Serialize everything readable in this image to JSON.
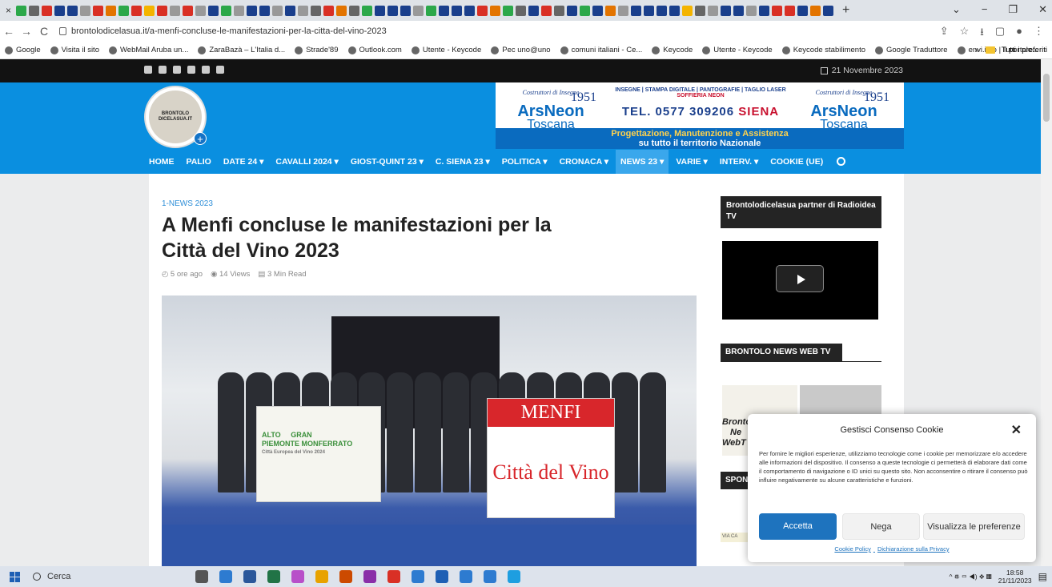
{
  "browser": {
    "tab_icon_colors": [
      "#2ca84a",
      "#666",
      "#d93025",
      "#1a3f8c",
      "#1a3f8c",
      "#999",
      "#d93025",
      "#e37400",
      "#2ca84a",
      "#d93025",
      "#f4b400",
      "#d93025",
      "#999",
      "#d93025",
      "#999",
      "#1a3f8c",
      "#2ca84a",
      "#999",
      "#1a3f8c",
      "#1a3f8c",
      "#999",
      "#1a3f8c",
      "#999",
      "#666",
      "#d93025",
      "#e37400",
      "#666",
      "#2ca84a",
      "#1a3f8c",
      "#1a3f8c",
      "#1a3f8c",
      "#999",
      "#2ca84a",
      "#1a3f8c",
      "#1a3f8c",
      "#1a3f8c",
      "#d93025",
      "#e37400",
      "#2ca84a",
      "#666",
      "#1a3f8c",
      "#d93025",
      "#666",
      "#1a3f8c",
      "#2ca84a",
      "#1a3f8c",
      "#e37400",
      "#999",
      "#1a3f8c",
      "#1a3f8c",
      "#1a3f8c",
      "#1a3f8c",
      "#f4b400",
      "#666",
      "#999",
      "#1a3f8c",
      "#1a3f8c",
      "#999",
      "#1a3f8c",
      "#d93025",
      "#d93025",
      "#1a3f8c",
      "#e37400",
      "#1a3f8c"
    ],
    "new_tab": "+",
    "close_tab": "×",
    "win_controls": [
      "⌄",
      "−",
      "❐",
      "✕"
    ],
    "nav": {
      "back": "←",
      "forward": "→",
      "reload": "C"
    },
    "url": "brontolodicelasua.it/a-menfi-concluse-le-manifestazioni-per-la-citta-del-vino-2023",
    "addr_icons": [
      "⇪",
      "☆",
      "⭳",
      "▢",
      "●",
      "⋮"
    ],
    "bookmarks": [
      "Google",
      "Visita il sito",
      "WebMail Aruba un...",
      "ZaraBazà – L'Italia d...",
      "Strade'89",
      "Outlook.com",
      "Utente - Keycode",
      "Pec uno@uno",
      "comuni italiani - Ce...",
      "Keycode",
      "Utente - Keycode",
      "Keycode stabilimento",
      "Google Traduttore",
      "envi.info | Il portale..."
    ],
    "bookmarks_more": "»",
    "bookmarks_folder": "Tutti i preferiti"
  },
  "site": {
    "date": "21 Novembre 2023",
    "social_icons": [
      "youtube-icon",
      "facebook-icon",
      "facebook-icon",
      "twitter-icon",
      "instagram-icon",
      "googleplus-icon"
    ],
    "logo_text": [
      "BRONTOLO",
      "DICELASUA.IT"
    ],
    "banner": {
      "script": "Costruttori di Insegne",
      "year": "1951",
      "brand": "ArsNeon",
      "brand2": "Toscana",
      "services": "INSEGNE | STAMPA DIGITALE | PANTOGRAFIE | TAGLIO LASER",
      "services2": "SOFFIERIA NEON",
      "phone": "TEL. 0577 309206",
      "city": "SIENA",
      "strip1": "Progettazione, Manutenzione e Assistenza",
      "strip2": "su tutto il territorio Nazionale"
    },
    "nav": [
      {
        "label": "HOME",
        "active": false
      },
      {
        "label": "PALIO",
        "active": false
      },
      {
        "label": "DATE 24 ▾",
        "active": false
      },
      {
        "label": "CAVALLI 2024 ▾",
        "active": false
      },
      {
        "label": "GIOST-QUINT 23 ▾",
        "active": false
      },
      {
        "label": "C. SIENA 23 ▾",
        "active": false
      },
      {
        "label": "POLITICA ▾",
        "active": false
      },
      {
        "label": "CRONACA ▾",
        "active": false
      },
      {
        "label": "NEWS 23 ▾",
        "active": true
      },
      {
        "label": "VARIE ▾",
        "active": false
      },
      {
        "label": "INTERV. ▾",
        "active": false
      },
      {
        "label": "COOKIE (UE)",
        "active": false
      }
    ],
    "accent_color": "#0a8fe0"
  },
  "article": {
    "category": "1-NEWS 2023",
    "title": "A Menfi concluse le manifestazioni per la Città del Vino 2023",
    "meta_time": "◴ 5 ore ago",
    "meta_views": "◉ 14 Views",
    "meta_read": "▤ 3 Min Read",
    "photo_flag1": [
      "ALTO",
      "GRAN",
      "PIEMONTE",
      "MONFERRATO"
    ],
    "photo_flag1_sub": "Città Europea del Vino 2024",
    "photo_flag2_top": "MENFI",
    "photo_flag2_text": "Città del Vino"
  },
  "sidebar": {
    "partner": "Brontolodicelasua partner di Radioidea TV",
    "webtv": "BRONTOLO NEWS WEB TV",
    "thumb_text": [
      "Bronto",
      "Ne",
      "WebT"
    ],
    "spon": "SPON",
    "small": "VIA CA"
  },
  "cookie": {
    "title": "Gestisci Consenso Cookie",
    "close": "✕",
    "text": "Per fornire le migliori esperienze, utilizziamo tecnologie come i cookie per memorizzare e/o accedere alle informazioni del dispositivo. Il consenso a queste tecnologie ci permetterà di elaborare dati come il comportamento di navigazione o ID unici su questo sito. Non acconsentire o ritirare il consenso può influire negativamente su alcune caratteristiche e funzioni.",
    "accept": "Accetta",
    "deny": "Nega",
    "prefs": "Visualizza le preferenze",
    "link1": "Cookie Policy",
    "link2": "Dichiarazione sulla Privacy"
  },
  "taskbar": {
    "search": "Cerca",
    "icon_colors": [
      "#555",
      "#2d7bd0",
      "#2b579a",
      "#217346",
      "#b84fc9",
      "#e8a200",
      "#cc4a00",
      "#8a2fa8",
      "#d93025",
      "#2d7bd0",
      "#1e5fb4",
      "#2d7bd0",
      "#2d7bd0",
      "#1e9ee0"
    ],
    "time": "18:58",
    "date": "21/11/2023",
    "tray_icons": "^ ⛯ ▭ ◀) ❖ ▦"
  }
}
